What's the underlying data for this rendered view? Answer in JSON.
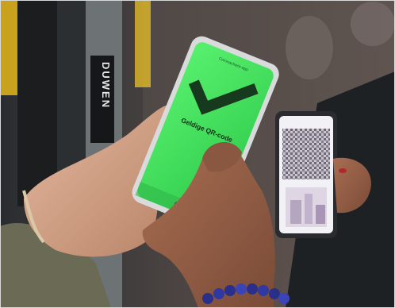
{
  "photo": {
    "main_phone": {
      "header_text": "Coronacheck-app",
      "status_text": "Geldige QR-code",
      "screen_color": "#3ee05a",
      "icon": "checkmark-icon"
    },
    "pole_sign": {
      "text": "DUWEN"
    },
    "second_phone": {
      "screen_color": "#f2f1f6",
      "icon": "qr-code-icon"
    }
  }
}
